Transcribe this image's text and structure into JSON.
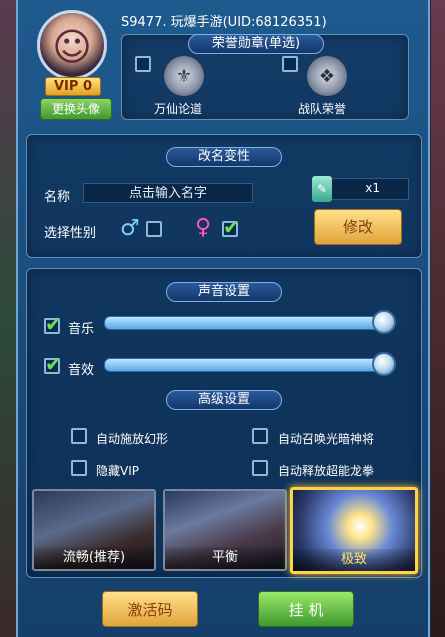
{
  "header": {
    "vip_label": "VIP 0",
    "change_avatar_label": "更换头像",
    "server_name": "S9477. 玩爆手游(UID:68126351)",
    "badge_title": "荣誉勋章(单选)",
    "badges": [
      {
        "label": "万仙论道"
      },
      {
        "label": "战队荣誉"
      }
    ]
  },
  "rename": {
    "section_title": "改名变性",
    "name_label": "名称",
    "name_placeholder": "点击输入名字",
    "card_count": "x1",
    "gender_label": "选择性别",
    "male_symbol": "♂",
    "female_symbol": "♀",
    "modify_label": "修改"
  },
  "sound": {
    "section_title": "声音设置",
    "music_label": "音乐",
    "effects_label": "音效",
    "music_volume_percent": 100,
    "effects_volume_percent": 100
  },
  "advanced": {
    "section_title": "高级设置",
    "options": [
      {
        "label": "自动施放幻形",
        "checked": false
      },
      {
        "label": "自动召唤光暗神将",
        "checked": false
      },
      {
        "label": "隐藏VIP",
        "checked": false
      },
      {
        "label": "自动释放超能龙拳",
        "checked": false
      }
    ]
  },
  "presets": [
    {
      "label": "流畅(推荐)",
      "selected": false
    },
    {
      "label": "平衡",
      "selected": false
    },
    {
      "label": "极致",
      "selected": true
    }
  ],
  "buttons": {
    "activation_code": "激活码",
    "idle": "挂 机"
  },
  "colors": {
    "panel_blue": "#1f5a8e",
    "accent_gold": "#ffd24a",
    "check_green": "#6ae05a",
    "female_pink": "#ff5ab4",
    "male_blue": "#7fd0ff"
  }
}
